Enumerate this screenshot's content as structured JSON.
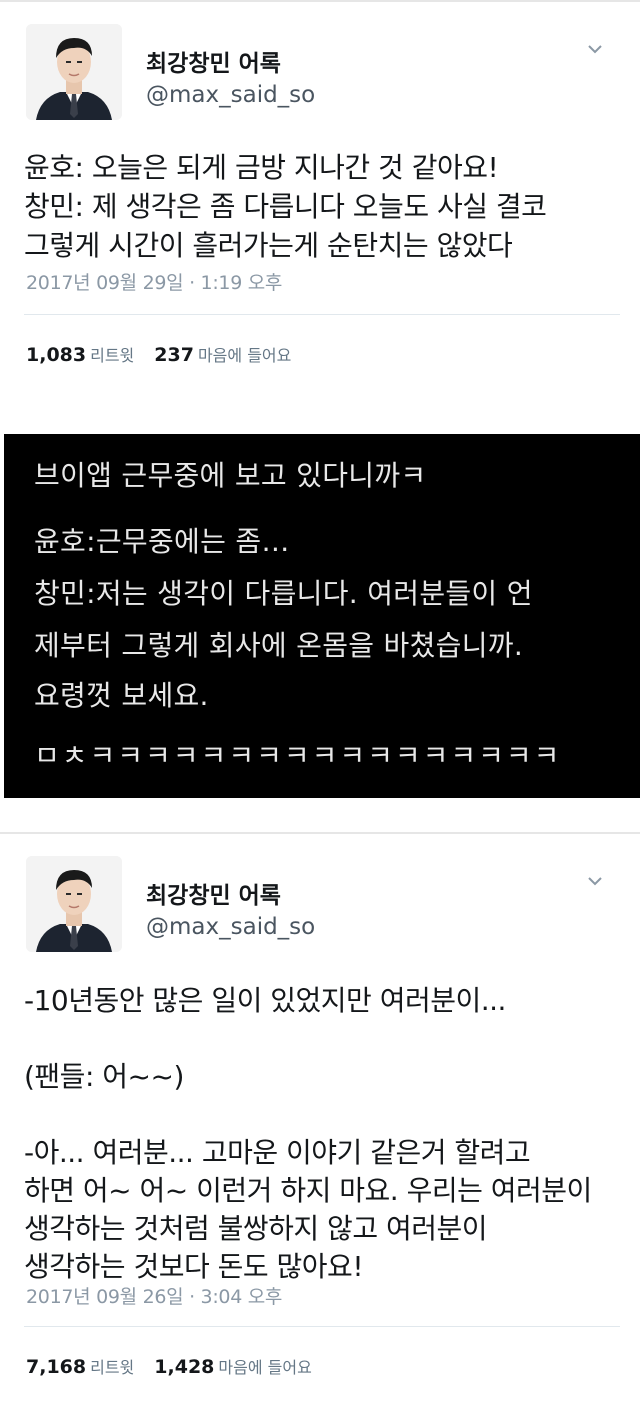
{
  "tweet1": {
    "display_name": "최강창민 어록",
    "handle": "@max_said_so",
    "text": "윤호: 오늘은 되게 금방 지나간 것 같아요!\n창민: 제 생각은 좀 다릅니다 오늘도 사실 결코\n그렇게 시간이 흘러가는게 순탄치는 않았다",
    "timestamp": "2017년 09월 29일 · 1:19 오후",
    "retweets": "1,083",
    "retweets_label": "리트윗",
    "likes": "237",
    "likes_label": "마음에 들어요",
    "chevron_icon": "chevron-down-icon"
  },
  "caption": {
    "line1": "브이앱 근무중에 보고 있다니까ㅋ",
    "line2": "윤호:근무중에는 좀…",
    "line3": "창민:저는 생각이 다릅니다. 여러분들이 언",
    "line4": "제부터 그렇게 회사에 온몸을 바쳤습니까.",
    "line5": "요령껏 보세요.",
    "line6": "ㅁㅊㅋㅋㅋㅋㅋㅋㅋㅋㅋㅋㅋㅋㅋㅋㅋㅋㅋ"
  },
  "tweet2": {
    "display_name": "최강창민 어록",
    "handle": "@max_said_so",
    "text": "-10년동안 많은 일이 있었지만 여러분이...\n\n(팬들: 어~~)\n\n-아... 여러분... 고마운 이야기 같은거 할려고\n하면 어~ 어~ 이런거 하지 마요.  우리는 여러분이\n생각하는 것처럼 불쌍하지 않고 여러분이\n생각하는 것보다 돈도 많아요!",
    "timestamp": "2017년 09월 26일 · 3:04 오후",
    "retweets": "7,168",
    "retweets_label": "리트윗",
    "likes": "1,428",
    "likes_label": "마음에 들어요",
    "chevron_icon": "chevron-down-icon"
  }
}
